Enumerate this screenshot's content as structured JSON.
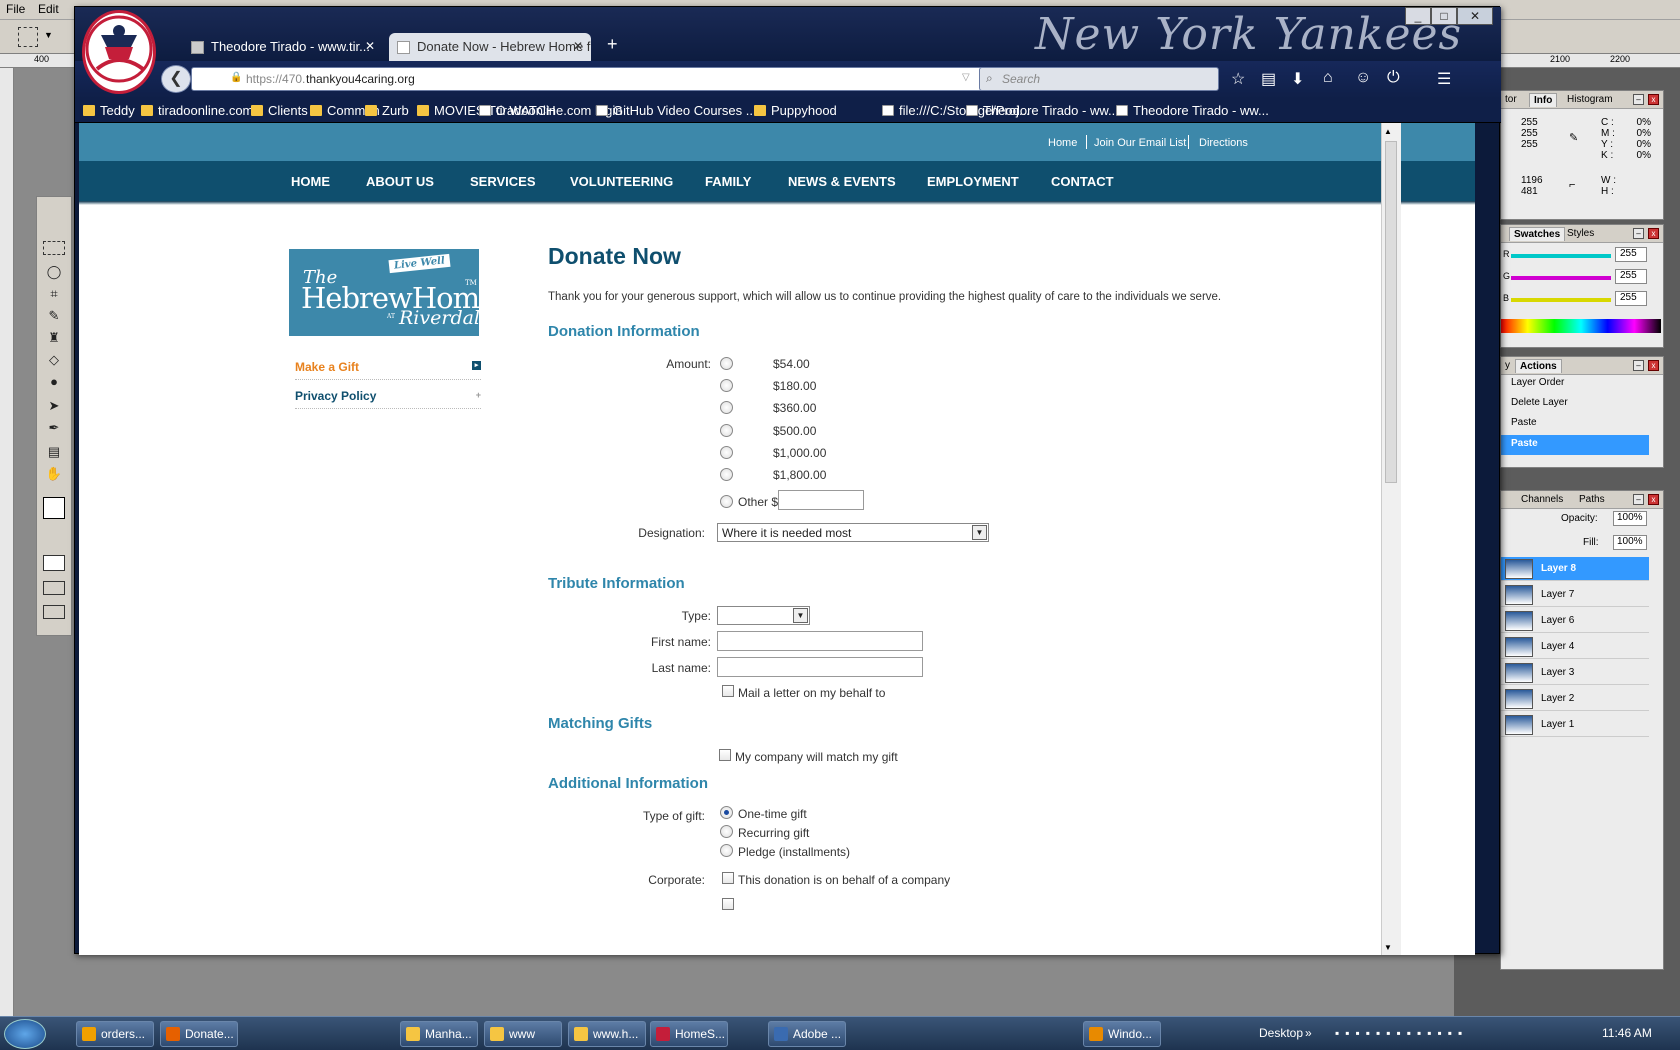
{
  "photoshop": {
    "menu": [
      "File",
      "Edit"
    ],
    "ruler_top": [
      "400",
      "2100",
      "2200"
    ],
    "info_panel": {
      "tabs": [
        "tor",
        "Info",
        "Histogram"
      ],
      "rgb": [
        "255",
        "255",
        "255"
      ],
      "cmyk": [
        {
          "k": "C :",
          "v": "0%"
        },
        {
          "k": "M :",
          "v": "0%"
        },
        {
          "k": "Y :",
          "v": "0%"
        },
        {
          "k": "K :",
          "v": "0%"
        }
      ],
      "xy": [
        "1196",
        "481"
      ],
      "wh": [
        "W :",
        "H :"
      ]
    },
    "swatches_panel": {
      "tabs": [
        "Swatches",
        "Styles"
      ],
      "sliders": [
        {
          "label": "R",
          "value": "255",
          "color": "#00c8c8"
        },
        {
          "label": "G",
          "value": "255",
          "color": "#d000d0"
        },
        {
          "label": "B",
          "value": "255",
          "color": "#d8d800"
        }
      ]
    },
    "history_panel": {
      "tabs": [
        "y",
        "Actions"
      ],
      "items": [
        "Layer Order",
        "Delete Layer",
        "Paste",
        "Paste"
      ],
      "selected_index": 3
    },
    "layers_panel": {
      "tabs": [
        "Channels",
        "Paths"
      ],
      "opacity_label": "Opacity:",
      "opacity": "100%",
      "fill_label": "Fill:",
      "fill": "100%",
      "layers": [
        "Layer 8",
        "Layer 7",
        "Layer 6",
        "Layer 4",
        "Layer 3",
        "Layer 2",
        "Layer 1"
      ],
      "selected_index": 0
    }
  },
  "browser": {
    "watermark": "New York Yankees",
    "tabs": [
      {
        "label": "Theodore Tirado - www.tir...",
        "active": false
      },
      {
        "label": "Donate Now - Hebrew Home f...",
        "active": true
      }
    ],
    "new_tab": "+",
    "url_prefix": "https://470.",
    "url_host": "thankyou4caring.org",
    "search_placeholder": "Search",
    "bookmarks": [
      {
        "label": "Teddy",
        "type": "folder"
      },
      {
        "label": "tiradoonline.com",
        "type": "folder"
      },
      {
        "label": "Clients",
        "type": "folder"
      },
      {
        "label": "Common",
        "type": "folder"
      },
      {
        "label": "Zurb",
        "type": "folder"
      },
      {
        "label": "MOVIES TO WATCH",
        "type": "folder"
      },
      {
        "label": "tiradoonline.com login",
        "type": "page"
      },
      {
        "label": "GitHub Video Courses ...",
        "type": "page"
      },
      {
        "label": "Puppyhood",
        "type": "folder"
      },
      {
        "label": "file:///C:/Storage/Proj...",
        "type": "page"
      },
      {
        "label": "Theodore Tirado - ww...",
        "type": "page"
      },
      {
        "label": "Theodore Tirado - ww...",
        "type": "page"
      }
    ]
  },
  "site": {
    "util_links": [
      "Home",
      "Join Our Email List",
      "Directions"
    ],
    "nav": [
      "HOME",
      "ABOUT US",
      "SERVICES",
      "VOLUNTEERING",
      "FAMILY",
      "NEWS & EVENTS",
      "EMPLOYMENT",
      "CONTACT"
    ],
    "logo": {
      "live": "Live Well",
      "the": "The",
      "name": "HebrewHome",
      "at": "AT",
      "riverdale": "Riverdale",
      "tm": "TM"
    },
    "sidebar": [
      {
        "label": "Make a Gift",
        "color": "#e8821e"
      },
      {
        "label": "Privacy Policy",
        "color": "#0f4f6e"
      }
    ]
  },
  "form": {
    "title": "Donate Now",
    "intro": "Thank you for your generous support, which will allow us to continue providing the highest quality of care to the individuals we serve.",
    "donation_heading": "Donation Information",
    "amount_label": "Amount:",
    "amounts": [
      "$54.00",
      "$180.00",
      "$360.00",
      "$500.00",
      "$1,000.00",
      "$1,800.00"
    ],
    "other_label": "Other $",
    "other_value": "",
    "designation_label": "Designation:",
    "designation_value": "Where it is needed most",
    "tribute_heading": "Tribute Information",
    "type_label": "Type:",
    "type_value": "",
    "first_name_label": "First name:",
    "first_name_value": "",
    "last_name_label": "Last name:",
    "last_name_value": "",
    "mail_letter": "Mail a letter on my behalf to",
    "matching_heading": "Matching Gifts",
    "company_match": "My company will match my gift",
    "additional_heading": "Additional Information",
    "gift_type_label": "Type of gift:",
    "gift_types": [
      "One-time gift",
      "Recurring gift",
      "Pledge (installments)"
    ],
    "gift_type_selected": 0,
    "corporate_label": "Corporate:",
    "corporate_text": "This donation is on behalf of a company"
  },
  "taskbar": {
    "items": [
      {
        "label": "orders...",
        "color": "#f0a000"
      },
      {
        "label": "Donate...",
        "color": "#e66000"
      },
      {
        "label": "Manha...",
        "color": "#f5c542"
      },
      {
        "label": "www",
        "color": "#f5c542"
      },
      {
        "label": "www.h...",
        "color": "#f5c542"
      },
      {
        "label": "HomeS...",
        "color": "#c41e3a"
      },
      {
        "label": "Adobe ...",
        "color": "#3a6bb0"
      },
      {
        "label": "Windo...",
        "color": "#e88a00"
      }
    ],
    "desktop_label": "Desktop",
    "clock": "11:46 AM"
  }
}
